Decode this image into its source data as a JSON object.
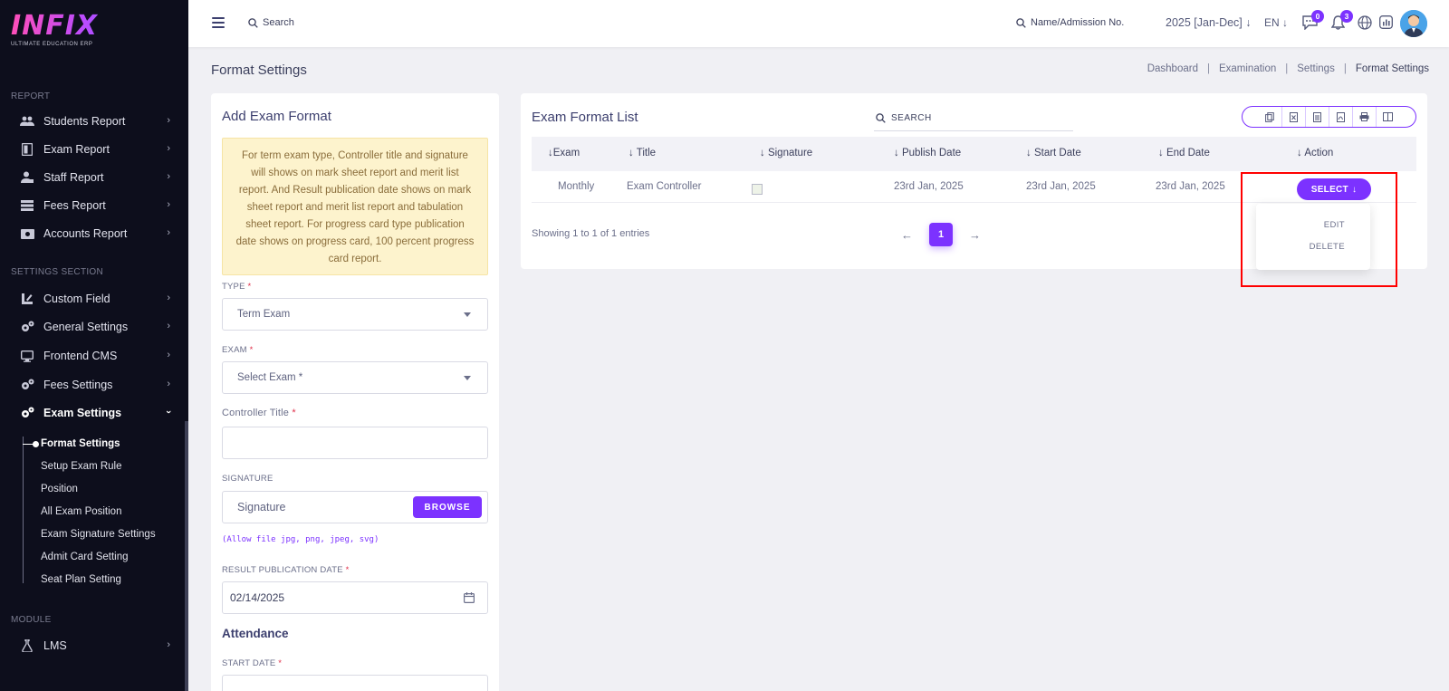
{
  "brand": {
    "logo_text": "INFIX",
    "logo_sub": "ULTIMATE EDUCATION ERP"
  },
  "sidebar": {
    "section_report": "REPORT",
    "report_items": [
      {
        "label": "Students Report",
        "icon": "users-icon"
      },
      {
        "label": "Exam Report",
        "icon": "document-icon"
      },
      {
        "label": "Staff Report",
        "icon": "user-tie-icon"
      },
      {
        "label": "Fees Report",
        "icon": "money-icon"
      },
      {
        "label": "Accounts Report",
        "icon": "wallet-icon"
      }
    ],
    "section_settings": "SETTINGS SECTION",
    "settings_items": [
      {
        "label": "Custom Field",
        "icon": "pencil-ruler-icon"
      },
      {
        "label": "General Settings",
        "icon": "gears-icon"
      },
      {
        "label": "Frontend CMS",
        "icon": "monitor-icon"
      },
      {
        "label": "Fees Settings",
        "icon": "gears-icon"
      },
      {
        "label": "Exam Settings",
        "icon": "gears-icon"
      }
    ],
    "exam_settings_sub": [
      "Format Settings",
      "Setup Exam Rule",
      "Position",
      "All Exam Position",
      "Exam Signature Settings",
      "Admit Card Setting",
      "Seat Plan Setting"
    ],
    "section_module": "MODULE",
    "module_items": [
      {
        "label": "LMS",
        "icon": "flask-icon"
      }
    ]
  },
  "topbar": {
    "search_label": "Search",
    "student_search_label": "Name/Admission No.",
    "session": "2025 [Jan-Dec]",
    "language": "EN",
    "chat_count": "0",
    "notification_count": "3"
  },
  "page": {
    "title": "Format Settings",
    "breadcrumb": [
      "Dashboard",
      "Examination",
      "Settings",
      "Format Settings"
    ]
  },
  "form": {
    "title": "Add Exam Format",
    "note": "For term exam type, Controller title and signature will shows on mark sheet report and merit list report. And Result publication date shows on mark sheet report and merit list report and tabulation sheet report. For progress card type publication date shows on progress card, 100 percent progress card report.",
    "type_label": "TYPE",
    "type_value": "Term Exam",
    "exam_label": "EXAM",
    "exam_placeholder": "Select Exam *",
    "controller_label": "Controller Title",
    "controller_value": "",
    "signature_label": "SIGNATURE",
    "signature_placeholder": "Signature",
    "browse_label": "BROWSE",
    "file_hint": "(Allow file jpg, png, jpeg, svg)",
    "publication_label": "RESULT PUBLICATION DATE",
    "publication_value": "02/14/2025",
    "attendance_title": "Attendance",
    "start_date_label": "START DATE",
    "required_mark": "*"
  },
  "list": {
    "title": "Exam Format List",
    "search_placeholder": "SEARCH",
    "columns": [
      "Exam",
      "Title",
      "Signature",
      "Publish Date",
      "Start Date",
      "End Date",
      "Action"
    ],
    "rows": [
      {
        "exam": "Monthly",
        "title": "Exam Controller",
        "publish": "23rd Jan, 2025",
        "start": "23rd Jan, 2025",
        "end": "23rd Jan, 2025"
      }
    ],
    "select_label": "SELECT",
    "actions": [
      "EDIT",
      "DELETE"
    ],
    "showing": "Showing 1 to 1 of 1 entries",
    "current_page": "1"
  },
  "colors": {
    "accent": "#7c32ff",
    "sidebar": "#0d0e1c",
    "highlight": "#ff0000"
  }
}
